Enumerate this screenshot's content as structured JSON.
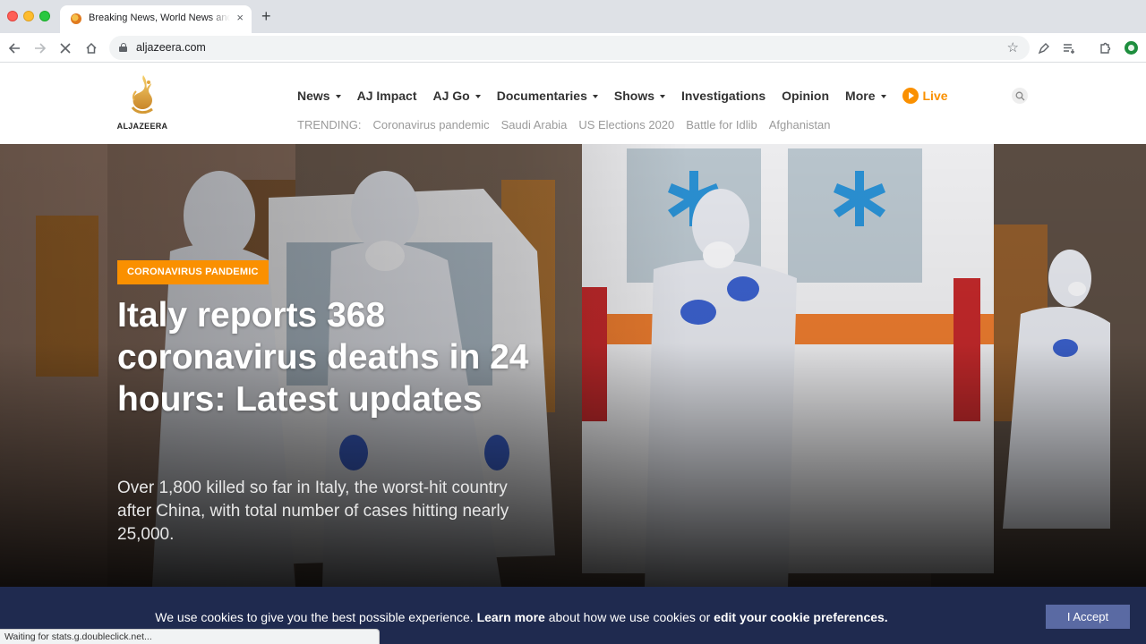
{
  "browser": {
    "tab_title": "Breaking News, World News and Video from Al Jazeera",
    "tab_close": "×",
    "new_tab": "+",
    "url": "aljazeera.com",
    "status_text": "Waiting for stats.g.doubleclick.net...",
    "icons": [
      "back-icon",
      "forward-icon",
      "stop-loading-icon",
      "home-icon",
      "lock-icon",
      "star-icon",
      "extension-icons"
    ]
  },
  "site": {
    "logo_text": "ALJAZEERA",
    "nav": [
      {
        "label": "News",
        "dropdown": true
      },
      {
        "label": "AJ Impact",
        "dropdown": false
      },
      {
        "label": "AJ Go",
        "dropdown": true
      },
      {
        "label": "Documentaries",
        "dropdown": true
      },
      {
        "label": "Shows",
        "dropdown": true
      },
      {
        "label": "Investigations",
        "dropdown": false
      },
      {
        "label": "Opinion",
        "dropdown": false
      },
      {
        "label": "More",
        "dropdown": true
      }
    ],
    "live_label": "Live",
    "trending_label": "TRENDING:",
    "trending": [
      "Coronavirus pandemic",
      "Saudi Arabia",
      "US Elections 2020",
      "Battle for Idlib",
      "Afghanistan"
    ]
  },
  "hero": {
    "tag": "CORONAVIRUS PANDEMIC",
    "headline": "Italy reports 368 coronavirus deaths in 24 hours: Latest updates",
    "summary": "Over 1,800 killed so far in Italy, the worst-hit country after China, with total number of cases hitting nearly 25,000."
  },
  "cookie": {
    "text_1": "We use cookies to give you the best possible experience. ",
    "link_learn": "Learn more",
    "text_2": " about how we use cookies or ",
    "link_prefs": "edit your cookie preferences.",
    "accept_label": "I Accept"
  },
  "colors": {
    "brand_orange": "#fa9000",
    "cookie_bg": "#1f2a4f",
    "accept_bg": "#5a6aa3"
  }
}
